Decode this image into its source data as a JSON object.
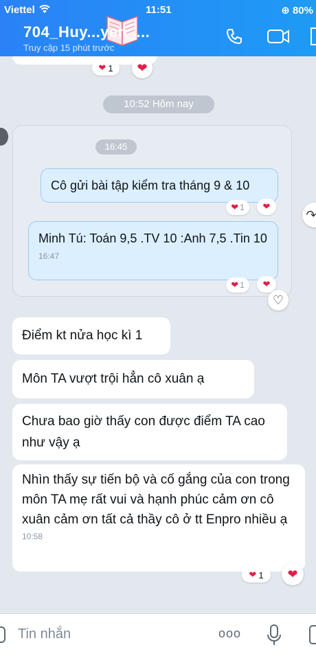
{
  "status_bar": {
    "carrier": "Viettel",
    "time": "11:51",
    "battery": "80%"
  },
  "header": {
    "title": "704_Huy...yen_...",
    "subtitle": "Truy cập 15 phút trước"
  },
  "timestamps": {
    "today_separator": "10:52 Hôm nay"
  },
  "prev_reaction": {
    "count": "1"
  },
  "forward_group": {
    "time_pill": "16:45",
    "msg1": "Cô gửi bài tập kiểm tra tháng 9 & 10",
    "msg1_react_count": "1",
    "msg2": "Minh Tú: Toán 9,5 .TV 10 :Anh 7,5 .Tin 10",
    "msg2_time": "16:47",
    "msg2_react_count": "1"
  },
  "messages": [
    {
      "text": "Điểm kt nửa học kì 1"
    },
    {
      "text": "Môn  TA  vượt trội hẳn cô xuân ạ"
    },
    {
      "text": "Chưa bao giờ thấy con được điểm TA cao như vậy ạ"
    },
    {
      "text": "Nhìn thấy sự tiến bộ và cố gắng của con trong môn TA mẹ rất vui và hạnh phúc cảm ơn cô xuân cảm ơn tất cả thầy cô ở tt Enpro nhiều ạ",
      "time": "10:58",
      "react_count": "1"
    }
  ],
  "input_bar": {
    "placeholder": "Tin nhắn",
    "more": "ooo"
  },
  "colors": {
    "header_blue": "#2a82f6",
    "heart": "#e11d48"
  }
}
